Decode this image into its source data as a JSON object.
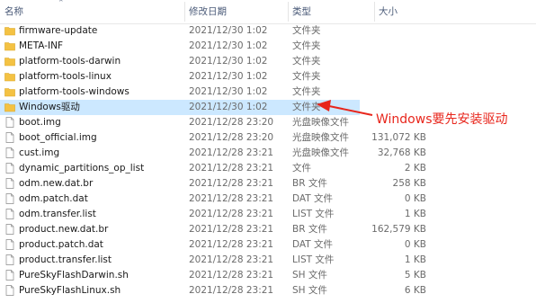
{
  "columns": {
    "name": "名称",
    "date": "修改日期",
    "type": "类型",
    "size": "大小"
  },
  "rows": [
    {
      "name": "firmware-update",
      "date": "2021/12/30 1:02",
      "type": "文件夹",
      "size": "",
      "icon": "folder-icon"
    },
    {
      "name": "META-INF",
      "date": "2021/12/30 1:02",
      "type": "文件夹",
      "size": "",
      "icon": "folder-icon"
    },
    {
      "name": "platform-tools-darwin",
      "date": "2021/12/30 1:02",
      "type": "文件夹",
      "size": "",
      "icon": "folder-icon"
    },
    {
      "name": "platform-tools-linux",
      "date": "2021/12/30 1:02",
      "type": "文件夹",
      "size": "",
      "icon": "folder-icon"
    },
    {
      "name": "platform-tools-windows",
      "date": "2021/12/30 1:02",
      "type": "文件夹",
      "size": "",
      "icon": "folder-icon"
    },
    {
      "name": "Windows驱动",
      "date": "2021/12/30 1:02",
      "type": "文件夹",
      "size": "",
      "icon": "folder-icon",
      "selected": true
    },
    {
      "name": "boot.img",
      "date": "2021/12/28 23:20",
      "type": "光盘映像文件",
      "size": "",
      "icon": "file-icon"
    },
    {
      "name": "boot_official.img",
      "date": "2021/12/28 23:20",
      "type": "光盘映像文件",
      "size": "131,072 KB",
      "icon": "file-icon"
    },
    {
      "name": "cust.img",
      "date": "2021/12/28 23:21",
      "type": "光盘映像文件",
      "size": "32,768 KB",
      "icon": "file-icon"
    },
    {
      "name": "dynamic_partitions_op_list",
      "date": "2021/12/28 23:21",
      "type": "文件",
      "size": "2 KB",
      "icon": "file-icon"
    },
    {
      "name": "odm.new.dat.br",
      "date": "2021/12/28 23:21",
      "type": "BR 文件",
      "size": "258 KB",
      "icon": "file-icon"
    },
    {
      "name": "odm.patch.dat",
      "date": "2021/12/28 23:21",
      "type": "DAT 文件",
      "size": "0 KB",
      "icon": "file-icon"
    },
    {
      "name": "odm.transfer.list",
      "date": "2021/12/28 23:21",
      "type": "LIST 文件",
      "size": "1 KB",
      "icon": "file-icon"
    },
    {
      "name": "product.new.dat.br",
      "date": "2021/12/28 23:21",
      "type": "BR 文件",
      "size": "162,579 KB",
      "icon": "file-icon"
    },
    {
      "name": "product.patch.dat",
      "date": "2021/12/28 23:21",
      "type": "DAT 文件",
      "size": "0 KB",
      "icon": "file-icon"
    },
    {
      "name": "product.transfer.list",
      "date": "2021/12/28 23:21",
      "type": "LIST 文件",
      "size": "1 KB",
      "icon": "file-icon"
    },
    {
      "name": "PureSkyFlashDarwin.sh",
      "date": "2021/12/28 23:21",
      "type": "SH 文件",
      "size": "5 KB",
      "icon": "file-icon"
    },
    {
      "name": "PureSkyFlashLinux.sh",
      "date": "2021/12/28 23:21",
      "type": "SH 文件",
      "size": "6 KB",
      "icon": "file-icon"
    }
  ],
  "annotation": {
    "text": "Windows要先安装驱动",
    "color": "#e8261c"
  },
  "colors": {
    "selection": "#cce8ff",
    "folder": "#f4c243",
    "header_text": "#4a5a78"
  }
}
